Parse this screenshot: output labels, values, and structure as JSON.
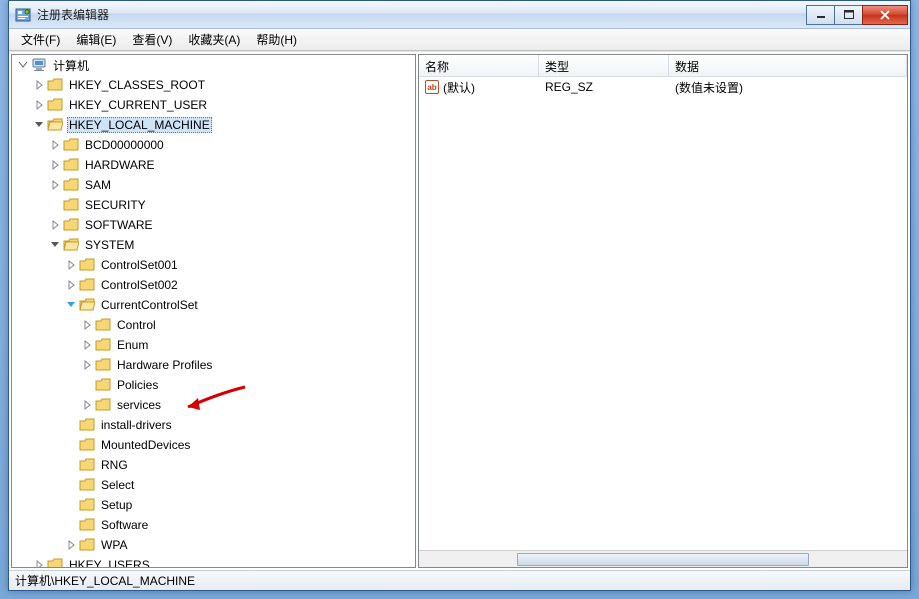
{
  "window": {
    "title": "注册表编辑器"
  },
  "menu": {
    "file": "文件(F)",
    "edit": "编辑(E)",
    "view": "查看(V)",
    "favorites": "收藏夹(A)",
    "help": "帮助(H)"
  },
  "tree": {
    "root": "计算机",
    "hkcr": "HKEY_CLASSES_ROOT",
    "hkcu": "HKEY_CURRENT_USER",
    "hklm": "HKEY_LOCAL_MACHINE",
    "hku": "HKEY_USERS",
    "hklm_children": {
      "bcd": "BCD00000000",
      "hardware": "HARDWARE",
      "sam": "SAM",
      "security": "SECURITY",
      "software": "SOFTWARE",
      "system": "SYSTEM"
    },
    "system_children": {
      "cs001": "ControlSet001",
      "cs002": "ControlSet002",
      "ccs": "CurrentControlSet",
      "install_drivers": "install-drivers",
      "mounted": "MountedDevices",
      "rng": "RNG",
      "select": "Select",
      "setup": "Setup",
      "software2": "Software",
      "wpa": "WPA"
    },
    "ccs_children": {
      "control": "Control",
      "enum": "Enum",
      "hwprofiles": "Hardware Profiles",
      "policies": "Policies",
      "services": "services"
    }
  },
  "list": {
    "headers": {
      "name": "名称",
      "type": "类型",
      "data": "数据"
    },
    "rows": [
      {
        "name": "(默认)",
        "type": "REG_SZ",
        "data": "(数值未设置)"
      }
    ]
  },
  "statusbar": {
    "path": "计算机\\HKEY_LOCAL_MACHINE"
  }
}
